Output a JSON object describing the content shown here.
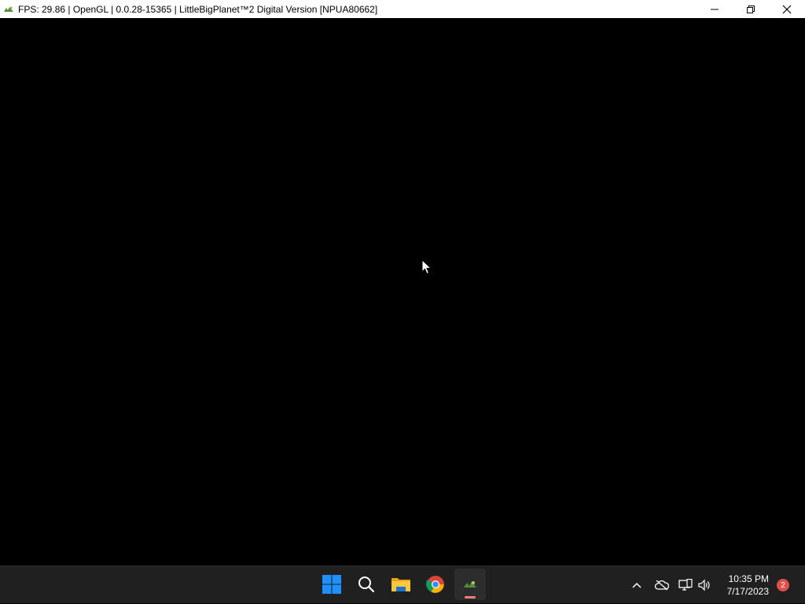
{
  "window": {
    "title": "FPS: 29.86 | OpenGL | 0.0.28-15365 | LittleBigPlanet™2 Digital Version [NPUA80662]",
    "app_icon": "rpcs3-icon",
    "controls": [
      "minimize-icon",
      "restore-icon",
      "close-icon"
    ]
  },
  "taskbar": {
    "pinned": [
      {
        "name": "start",
        "icon": "windows-start-icon"
      },
      {
        "name": "search",
        "icon": "search-icon"
      },
      {
        "name": "file-explorer",
        "icon": "folder-icon"
      },
      {
        "name": "chrome",
        "icon": "chrome-icon"
      },
      {
        "name": "rpcs3",
        "icon": "rpcs3-icon",
        "active": true
      }
    ],
    "tray": {
      "icons": [
        "chevron-up-icon",
        "onedrive-icon",
        "network-icon",
        "volume-icon"
      ],
      "time": "10:35 PM",
      "date": "7/17/2023",
      "notification_count": "2"
    }
  },
  "colors": {
    "titlebar": "#ffffff",
    "game_background": "#000000",
    "taskbar": "#202020",
    "accent_windows": "#1e90ff",
    "notification_badge": "#e0504a"
  }
}
